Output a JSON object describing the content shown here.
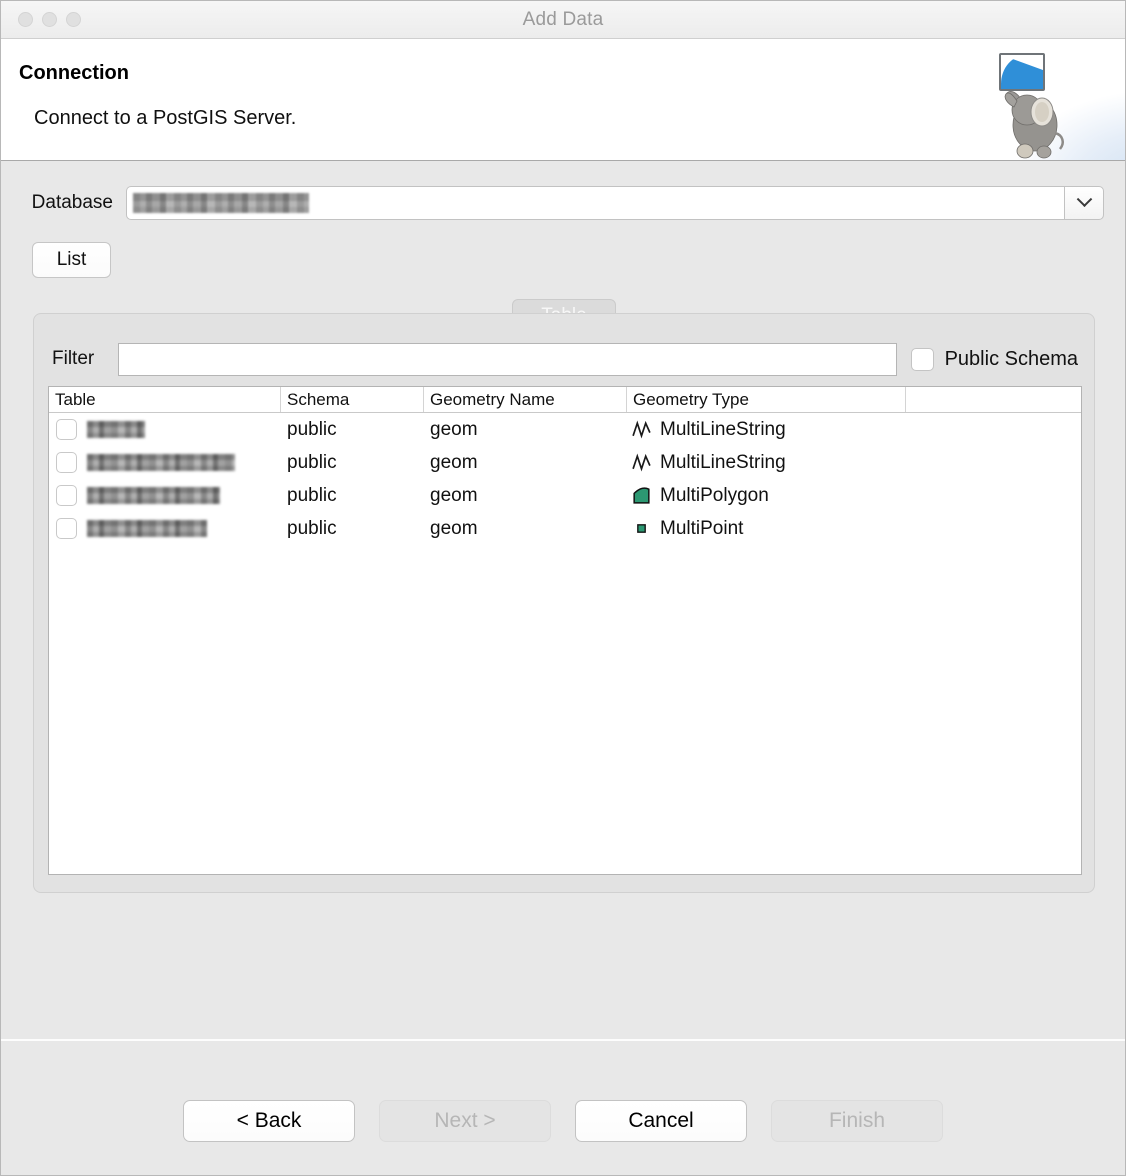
{
  "window": {
    "title": "Add Data",
    "traffic_lights": [
      "close",
      "minimize",
      "zoom"
    ]
  },
  "banner": {
    "title": "Connection",
    "subtitle": "Connect to a PostGIS Server.",
    "logo": "postgis-elephant-logo"
  },
  "form": {
    "database_label": "Database",
    "database_value": "",
    "database_redacted": true,
    "list_button": "List"
  },
  "group": {
    "tab_label": "Table",
    "filter_label": "Filter",
    "filter_value": "",
    "public_schema_label": "Public Schema",
    "public_schema_checked": false
  },
  "table": {
    "columns": [
      "Table",
      "Schema",
      "Geometry Name",
      "Geometry Type",
      ""
    ],
    "rows": [
      {
        "checked": false,
        "name": "",
        "redacted": true,
        "redact_width": 58,
        "schema": "public",
        "geometry_name": "geom",
        "geometry_type": "MultiLineString",
        "icon": "multilinestring-icon"
      },
      {
        "checked": false,
        "name": "",
        "redacted": true,
        "redact_width": 148,
        "schema": "public",
        "geometry_name": "geom",
        "geometry_type": "MultiLineString",
        "icon": "multilinestring-icon"
      },
      {
        "checked": false,
        "name": "",
        "redacted": true,
        "redact_width": 133,
        "schema": "public",
        "geometry_name": "geom",
        "geometry_type": "MultiPolygon",
        "icon": "multipolygon-icon"
      },
      {
        "checked": false,
        "name": "",
        "redacted": true,
        "redact_width": 120,
        "schema": "public",
        "geometry_name": "geom",
        "geometry_type": "MultiPoint",
        "icon": "multipoint-icon"
      }
    ]
  },
  "footer": {
    "back": "< Back",
    "next": "Next >",
    "cancel": "Cancel",
    "finish": "Finish",
    "back_enabled": true,
    "next_enabled": false,
    "cancel_enabled": true,
    "finish_enabled": false
  },
  "colors": {
    "geometry_green": "#2c9872",
    "window_bg": "#e8e8e8",
    "accent_blue": "#2f8fd8",
    "title_text": "#9a9a9a"
  }
}
